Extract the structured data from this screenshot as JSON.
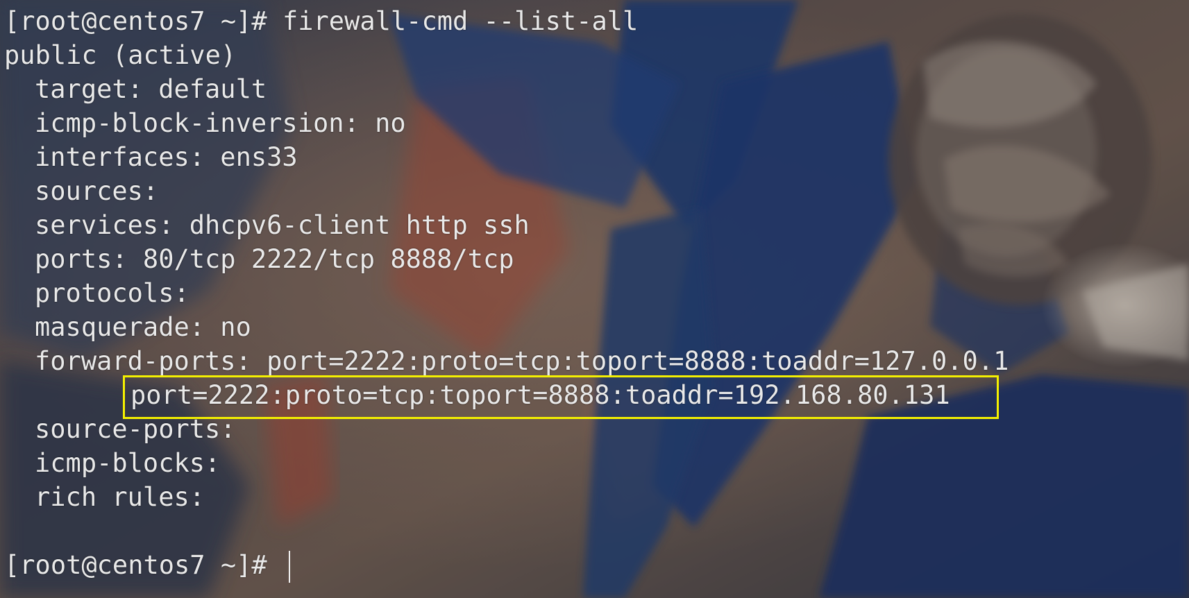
{
  "terminal": {
    "prompt_command": "[root@centos7 ~]# firewall-cmd --list-all",
    "zone": "public (active)",
    "target": "target: default",
    "icmp_block_inversion": "icmp-block-inversion: no",
    "interfaces": "interfaces: ens33",
    "sources": "sources:",
    "services": "services: dhcpv6-client http ssh",
    "ports": "ports: 80/tcp 2222/tcp 8888/tcp",
    "protocols": "protocols:",
    "masquerade": "masquerade: no",
    "forward_ports": "forward-ports: port=2222:proto=tcp:toport=8888:toaddr=127.0.0.1",
    "forward_ports_2": "port=2222:proto=tcp:toport=8888:toaddr=192.168.80.131",
    "source_ports": "source-ports:",
    "icmp_blocks": "icmp-blocks:",
    "rich_rules": "rich rules:",
    "final_prompt": "[root@centos7 ~]#"
  },
  "colors": {
    "text": "#e9e9e9",
    "highlight": "#f4f000"
  }
}
